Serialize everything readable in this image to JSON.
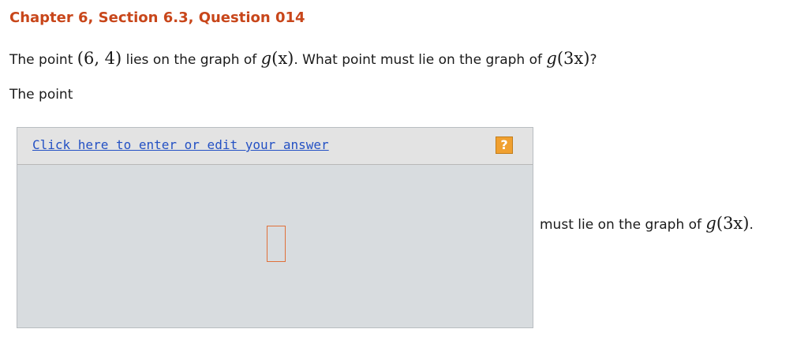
{
  "header": {
    "title": "Chapter 6, Section 6.3, Question 014"
  },
  "question": {
    "intro": "The point ",
    "point": "(6, 4)",
    "mid": " lies on the graph of ",
    "fn_name": "g",
    "fn_arg": "(x)",
    "mid2": ". What point must lie on the graph of ",
    "fn2_name": "g",
    "fn2_arg": "(3x)",
    "end": "?"
  },
  "prompt": {
    "text": "The point"
  },
  "answer": {
    "link_label": "Click here to enter or edit your answer",
    "help_label": "?",
    "value": ""
  },
  "suffix": {
    "text": "must lie on the graph of ",
    "fn_name": "g",
    "fn_arg": "(3x)",
    "end": "."
  },
  "colors": {
    "title": "#c8461a",
    "link": "#2451c4",
    "help": "#f0a030",
    "answer_border": "#e0703a"
  }
}
